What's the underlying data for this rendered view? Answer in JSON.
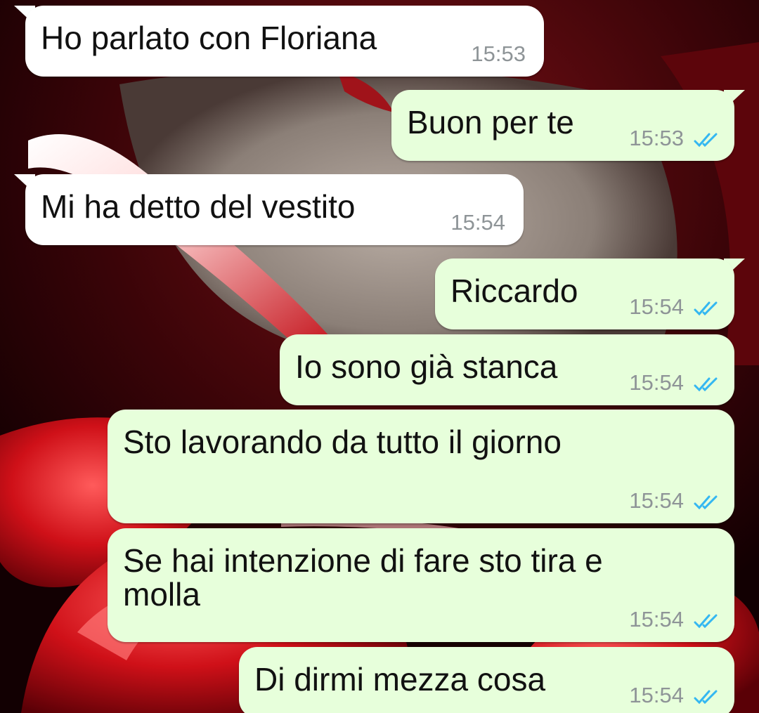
{
  "colors": {
    "incoming_bubble": "#ffffff",
    "outgoing_bubble": "#e7ffdb",
    "timestamp": "#8e9497",
    "read_ticks": "#34b7f1"
  },
  "messages": [
    {
      "direction": "incoming",
      "text": "Ho parlato con Floriana",
      "time": "15:53"
    },
    {
      "direction": "outgoing",
      "text": "Buon per te",
      "time": "15:53",
      "status_icon": "double-check-read-icon"
    },
    {
      "direction": "incoming",
      "text": "Mi ha detto del vestito",
      "time": "15:54"
    },
    {
      "direction": "outgoing",
      "text": "Riccardo",
      "time": "15:54",
      "status_icon": "double-check-read-icon"
    },
    {
      "direction": "outgoing",
      "text": "Io sono già stanca",
      "time": "15:54",
      "status_icon": "double-check-read-icon"
    },
    {
      "direction": "outgoing",
      "text": "Sto lavorando da tutto il giorno",
      "time": "15:54",
      "status_icon": "double-check-read-icon"
    },
    {
      "direction": "outgoing",
      "text": "Se hai intenzione di fare sto tira e\nmolla",
      "time": "15:54",
      "status_icon": "double-check-read-icon"
    },
    {
      "direction": "outgoing",
      "text": "Di dirmi mezza cosa",
      "time": "15:54",
      "status_icon": "double-check-read-icon"
    }
  ]
}
